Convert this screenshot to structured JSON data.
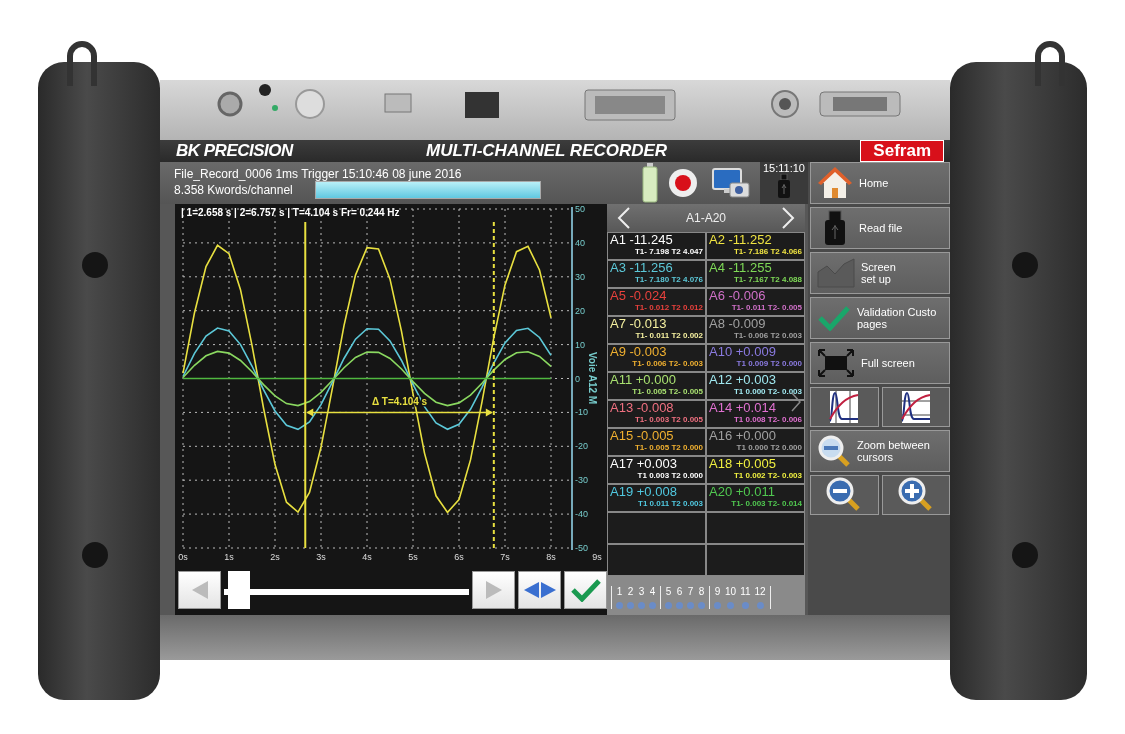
{
  "header": {
    "logo": "BK PRECISION",
    "title": "MULTI-CHANNEL RECORDER",
    "brand": "Sefram"
  },
  "status": {
    "file_line": "File_Record_0006  1ms  Trigger 15:10:46 08 june 2016",
    "memory": "8.358 Kwords/channel",
    "progress": {
      "level": 1
    },
    "clock": "15:11:10"
  },
  "plot": {
    "cursor_readout": "| 1=2.658 s | 2=6.757 s | T=4.104 s Fr= 0.244 Hz",
    "chart_data": {
      "type": "line",
      "ylabel": "Voie A12 M",
      "x": [
        0,
        0.25,
        0.5,
        0.75,
        1,
        1.25,
        1.5,
        1.75,
        2,
        2.25,
        2.5,
        2.75,
        3,
        3.25,
        3.5,
        3.75,
        4,
        4.25,
        4.5,
        4.75,
        5,
        5.25,
        5.5,
        5.75,
        6,
        6.25,
        6.5,
        6.75,
        7,
        7.25,
        7.5,
        7.75,
        8
      ],
      "series": [
        {
          "color": "#e8e040",
          "values": [
            1.6,
            19.4,
            33.0,
            39.3,
            36.8,
            26.2,
            9.8,
            -8.7,
            -25.4,
            -36.5,
            -39.4,
            -33.6,
            -20.3,
            -2.7,
            15.6,
            30.5,
            38.6,
            38.2,
            29.3,
            13.9,
            -4.5,
            -22.0,
            -34.6,
            -39.5,
            -35.7,
            -24.0,
            -6.9,
            11.6,
            27.6,
            37.4,
            39.0,
            32.0,
            17.9
          ]
        },
        {
          "color": "#5cc8d8",
          "values": [
            0.6,
            7.4,
            12.5,
            14.9,
            14.0,
            10.0,
            3.7,
            -3.3,
            -9.6,
            -13.8,
            -15.0,
            -12.8,
            -7.7,
            -1.0,
            5.9,
            11.6,
            14.7,
            14.5,
            11.1,
            5.3,
            -1.7,
            -8.3,
            -13.1,
            -15.0,
            -13.5,
            -9.1,
            -2.6,
            4.4,
            10.5,
            14.2,
            14.8,
            12.1,
            6.8
          ]
        },
        {
          "color": "#8ad860",
          "values": [
            0.3,
            3.9,
            6.7,
            8.0,
            7.5,
            5.3,
            2.0,
            -1.8,
            -5.1,
            -7.4,
            -8.0,
            -6.8,
            -4.1,
            -0.5,
            3.2,
            6.2,
            7.8,
            7.7,
            5.9,
            2.8,
            -0.9,
            -4.4,
            -7.0,
            -8.0,
            -7.2,
            -4.9,
            -1.4,
            2.4,
            5.6,
            7.6,
            7.9,
            6.5,
            3.6
          ]
        },
        {
          "color": "#50b840",
          "values": [
            0,
            0,
            0,
            0,
            0,
            0,
            0,
            0,
            0,
            0,
            0,
            0,
            0,
            0,
            0,
            0,
            0,
            0,
            0,
            0,
            0,
            0,
            0,
            0,
            0,
            0,
            0,
            0,
            0,
            0,
            0,
            0,
            0
          ]
        }
      ],
      "xlim": [
        0,
        9
      ],
      "ylim": [
        -50,
        50
      ],
      "grid": true,
      "xticks": [
        {
          "value": 0,
          "label": "0s"
        },
        {
          "value": 1,
          "label": "1s"
        },
        {
          "value": 2,
          "label": "2s"
        },
        {
          "value": 3,
          "label": "3s"
        },
        {
          "value": 4,
          "label": "4s"
        },
        {
          "value": 5,
          "label": "5s"
        },
        {
          "value": 6,
          "label": "6s"
        },
        {
          "value": 7,
          "label": "7s"
        },
        {
          "value": 8,
          "label": "8s"
        },
        {
          "value": 9,
          "label": "9s"
        }
      ],
      "yticks": [
        -50,
        -40,
        -30,
        -20,
        -10,
        0,
        10,
        20,
        30,
        40,
        50
      ],
      "ref_lines": [
        {
          "axis": "x",
          "value": 2.658,
          "color": "#e8e040"
        },
        {
          "axis": "x",
          "value": 6.757,
          "color": "#e8e040"
        }
      ],
      "annotations": [
        "Δ T=4.104 s"
      ]
    }
  },
  "channels": {
    "page": "A1-A20",
    "items": [
      {
        "reading": "A1 -11.245",
        "cursors": "T1- 7.198 T2 4.047",
        "color": "#ffffff"
      },
      {
        "reading": "A2 -11.252",
        "cursors": "T1- 7.186 T2 4.066",
        "color": "#f0e442"
      },
      {
        "reading": "A3 -11.256",
        "cursors": "T1- 7.180 T2 4.076",
        "color": "#5cc8d8"
      },
      {
        "reading": "A4 -11.255",
        "cursors": "T1- 7.167 T2 4.088",
        "color": "#7ed957"
      },
      {
        "reading": "A5 -0.024",
        "cursors": "T1- 0.012 T2 0.012",
        "color": "#e8413c"
      },
      {
        "reading": "A6 -0.006",
        "cursors": "T1- 0.011 T2- 0.005",
        "color": "#d070c8"
      },
      {
        "reading": "A7 -0.013",
        "cursors": "T1- 0.011 T2 0.002",
        "color": "#f5f0a0"
      },
      {
        "reading": "A8 -0.009",
        "cursors": "T1- 0.006 T2 0.003",
        "color": "#a0a0a0"
      },
      {
        "reading": "A9 -0.003",
        "cursors": "T1- 0.006 T2- 0.003",
        "color": "#f0b030"
      },
      {
        "reading": "A10 +0.009",
        "cursors": "T1 0.009 T2 0.000",
        "color": "#8a7ae0"
      },
      {
        "reading": "A11 +0.000",
        "cursors": "T1- 0.005 T2- 0.005",
        "color": "#a8e070"
      },
      {
        "reading": "A12 +0.003",
        "cursors": "T1 0.000 T2- 0.003",
        "color": "#a0e8f0"
      },
      {
        "reading": "A13 -0.008",
        "cursors": "T1- 0.003 T2 0.005",
        "color": "#f07080"
      },
      {
        "reading": "A14 +0.014",
        "cursors": "T1 0.008 T2- 0.006",
        "color": "#e070d0"
      },
      {
        "reading": "A15 -0.005",
        "cursors": "T1- 0.005 T2 0.000",
        "color": "#f0b030"
      },
      {
        "reading": "A16 +0.000",
        "cursors": "T1 0.000 T2 0.000",
        "color": "#a0a0a0"
      },
      {
        "reading": "A17 +0.003",
        "cursors": "T1 0.003 T2 0.000",
        "color": "#ffffff"
      },
      {
        "reading": "A18 +0.005",
        "cursors": "T1 0.002 T2- 0.003",
        "color": "#f0f040"
      },
      {
        "reading": "A19 +0.008",
        "cursors": "T1 0.011 T2 0.003",
        "color": "#50c8e0"
      },
      {
        "reading": "A20 +0.011",
        "cursors": "T1- 0.003 T2- 0.014",
        "color": "#50c850"
      }
    ],
    "groups": [
      [
        "1",
        "2",
        "3",
        "4"
      ],
      [
        "5",
        "6",
        "7",
        "8"
      ],
      [
        "9",
        "10",
        "11",
        "12"
      ]
    ]
  },
  "menu": [
    {
      "kind": "button",
      "lines": [
        "Home"
      ]
    },
    {
      "kind": "button",
      "lines": [
        "Read file"
      ]
    },
    {
      "kind": "button",
      "lines": [
        "Screen",
        "set up"
      ]
    },
    {
      "kind": "button",
      "lines": [
        "Validation Custo",
        "pages"
      ]
    },
    {
      "kind": "button",
      "lines": [
        "Full screen"
      ]
    },
    {
      "kind": "pair"
    },
    {
      "kind": "button",
      "lines": [
        "Zoom between",
        "cursors"
      ]
    },
    {
      "kind": "pair"
    }
  ]
}
